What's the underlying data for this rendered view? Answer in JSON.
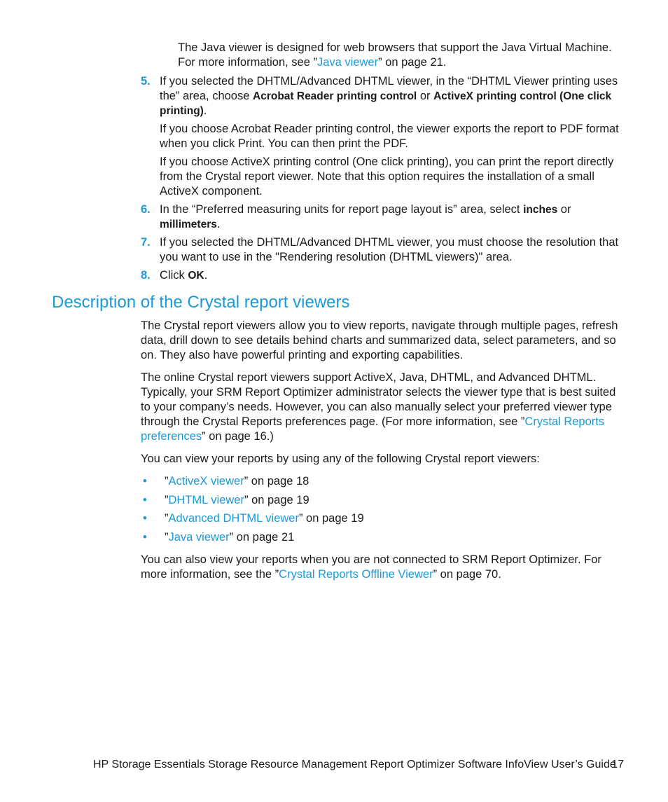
{
  "intro": {
    "text_before": "The Java viewer is designed for web browsers that support the Java Virtual Machine. For more information, see ”",
    "link": "Java viewer",
    "text_after": "” on page 21."
  },
  "steps": [
    {
      "number": "5.",
      "t1": "If you selected the DHTML/Advanced DHTML viewer, in the “DHTML Viewer printing uses the” area, choose ",
      "b1": "Acrobat Reader printing control",
      "t2": " or ",
      "b2": "ActiveX printing control (One click printing)",
      "t3": ".",
      "sub": [
        "If you choose Acrobat Reader printing control, the viewer exports the report to PDF format when you click Print. You can then print the PDF.",
        "If you choose ActiveX printing control (One click printing), you can print the report directly from the Crystal report viewer. Note that this option requires the installation of a small ActiveX component."
      ]
    },
    {
      "number": "6.",
      "t1": "In the “Preferred measuring units for report page layout is” area, select ",
      "b1": "inches",
      "t2": " or ",
      "b2": "millimeters",
      "t3": "."
    },
    {
      "number": "7.",
      "text": "If you selected the DHTML/Advanced DHTML viewer, you must choose the resolution that you want to use in the \"Rendering resolution (DHTML viewers)\" area."
    },
    {
      "number": "8.",
      "t1": "Click ",
      "b1": "OK",
      "t3": "."
    }
  ],
  "section": {
    "heading": "Description of the Crystal report viewers",
    "para1": "The Crystal report viewers allow you to view reports, navigate through multiple pages, refresh data, drill down to see details behind charts and summarized data, select parameters, and so on. They also have powerful printing and exporting capabilities.",
    "para2_text": "The online Crystal report viewers support ActiveX, Java, DHTML, and Advanced DHTML. Typically, your SRM Report Optimizer administrator selects the viewer type that is best suited to your company’s needs. However, you can also manually select your preferred viewer type through the Crystal Reports preferences page. (For more information, see ”",
    "para2_link": "Crystal Reports preferences",
    "para2_after": "” on page 16.)",
    "para3": "You can view your reports by using any of the following Crystal report viewers:",
    "bullet_glyph": "•",
    "viewers": [
      {
        "open": "”",
        "link": "ActiveX viewer",
        "after": "” on page 18"
      },
      {
        "open": "”",
        "link": "DHTML viewer",
        "after": "” on page 19"
      },
      {
        "open": "”",
        "link": "Advanced DHTML viewer",
        "after": "” on page 19"
      },
      {
        "open": "”",
        "link": "Java viewer",
        "after": "” on page 21"
      }
    ],
    "para4_text": "You can also view your reports when you are not connected to SRM Report Optimizer. For more information, see the ”",
    "para4_link": "Crystal Reports Offline Viewer",
    "para4_after": "” on page 70."
  },
  "footer": {
    "title": "HP Storage Essentials Storage Resource Management Report Optimizer Software InfoView User’s Guide",
    "page_number": "17"
  }
}
